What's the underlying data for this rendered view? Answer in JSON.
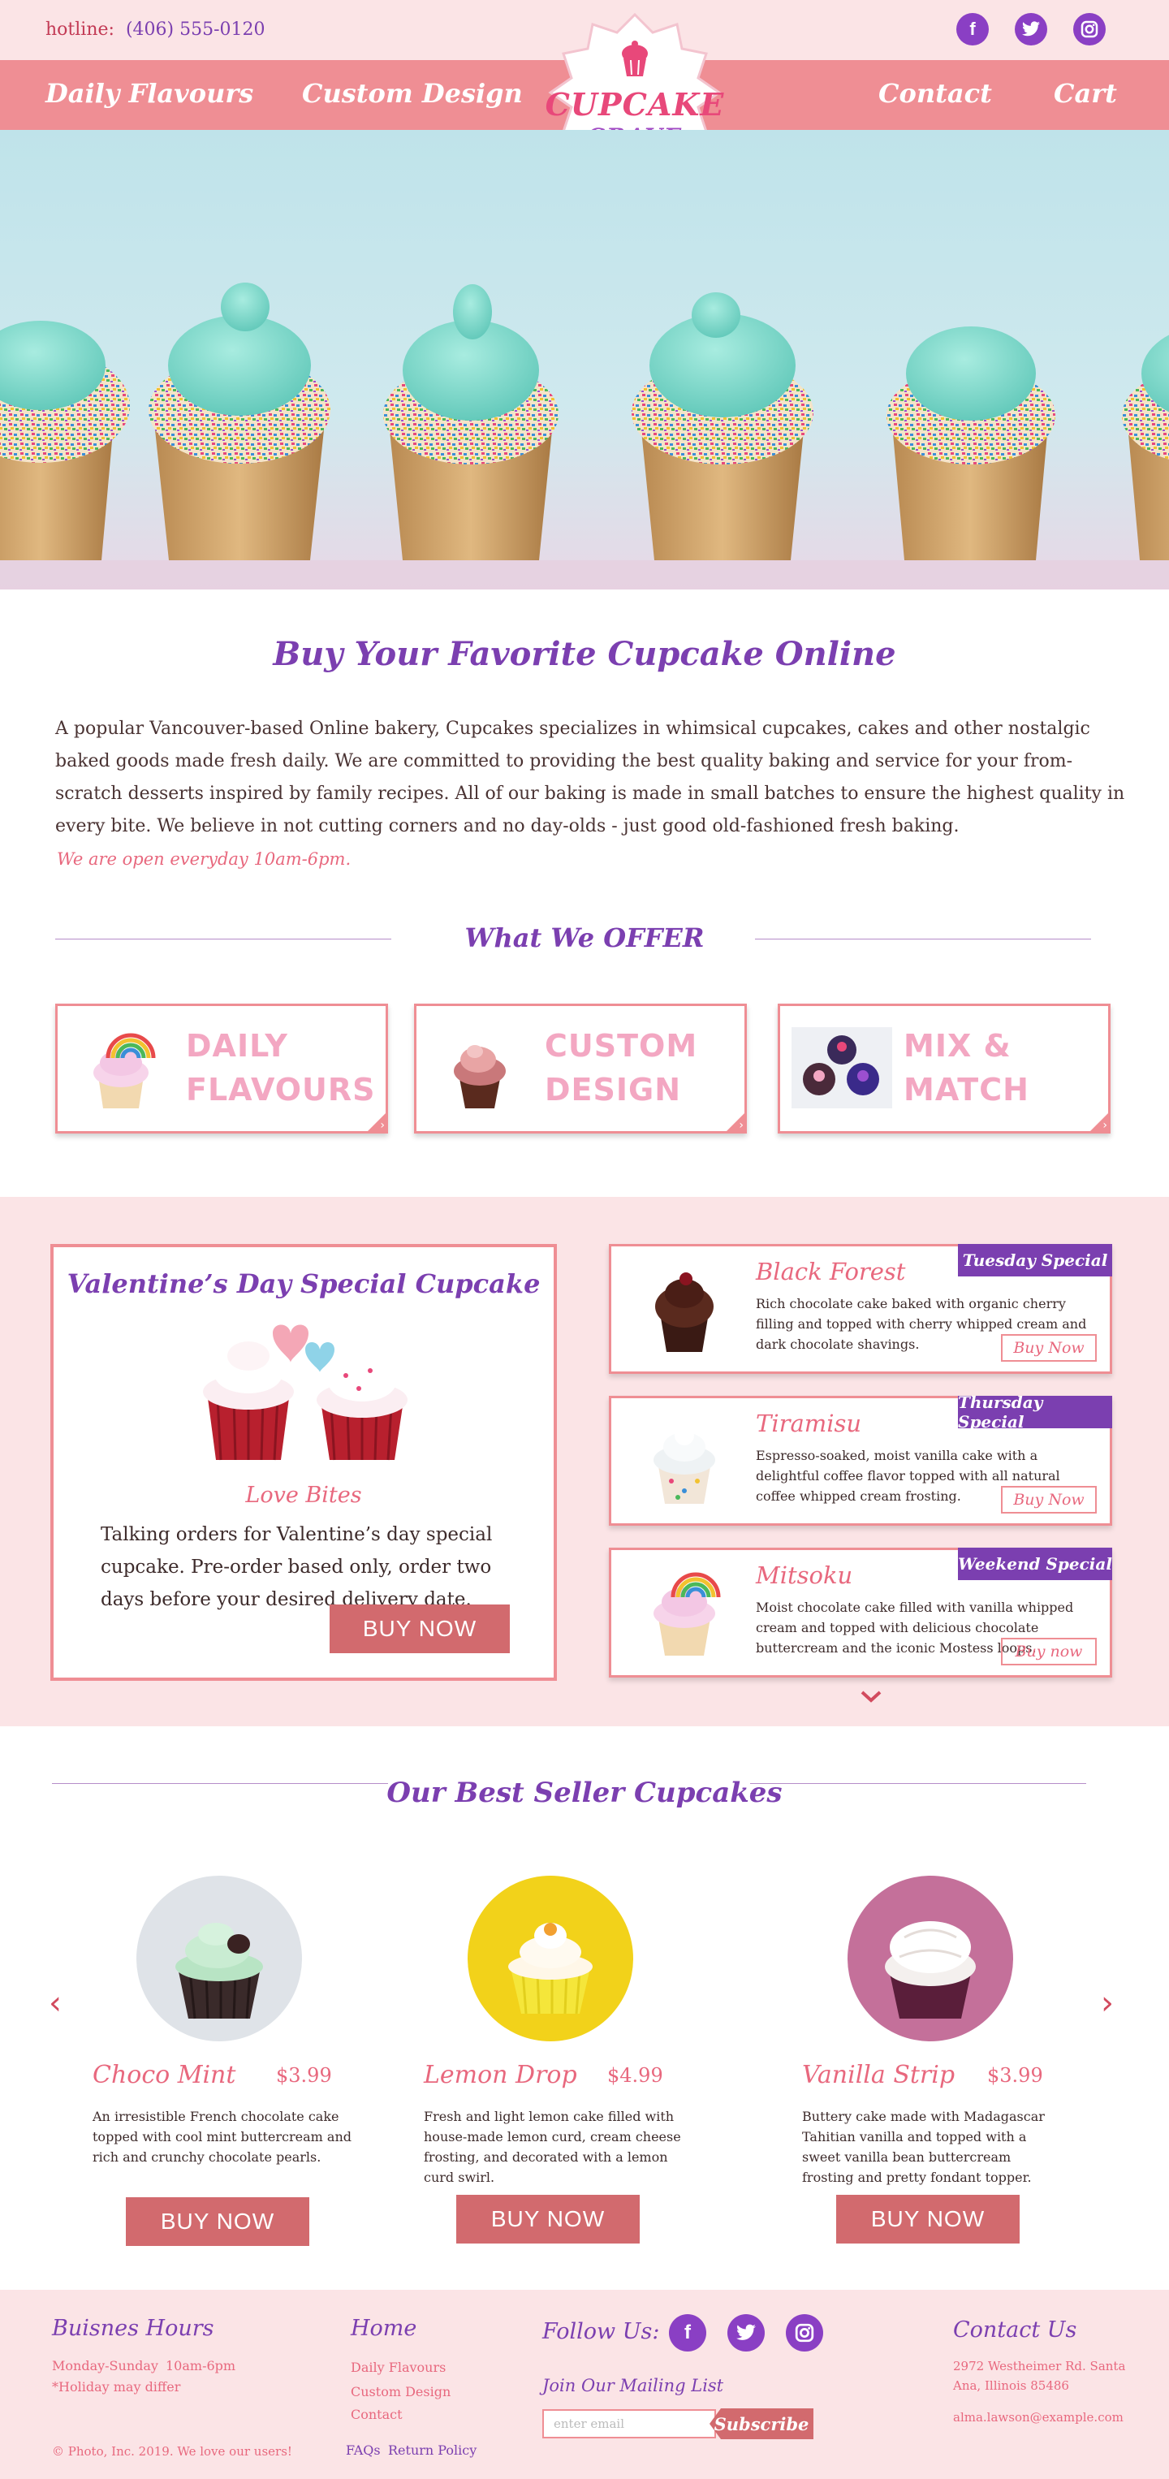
{
  "topbar": {
    "hotline_label": "hotline:",
    "hotline_number": "(406) 555-0120",
    "social": [
      "facebook-icon",
      "twitter-icon",
      "instagram-icon"
    ]
  },
  "nav": {
    "items": [
      "Daily Flavours",
      "Custom Design",
      "Contact",
      "Cart"
    ],
    "logo_line1": "CUPCAKE",
    "logo_line2": "CRAVE"
  },
  "intro": {
    "title": "Buy Your Favorite Cupcake Online",
    "text": "A popular Vancouver-based Online bakery, Cupcakes specializes in whimsical cupcakes, cakes and other nostalgic baked goods made fresh daily.  We are committed to providing the best quality baking and service for your  from-scratch desserts inspired by family recipes. All of our baking is made in small batches to ensure the highest quality in every bite. We believe in not cutting corners and no day-olds - just good old-fashioned fresh baking.",
    "hours": "We are open everyday 10am-6pm."
  },
  "offer": {
    "title": "What We OFFER",
    "cards": [
      {
        "line1": "DAILY",
        "line2": "FLAVOURS"
      },
      {
        "line1": "CUSTOM",
        "line2": "DESIGN"
      },
      {
        "line1": "MIX &",
        "line2": "MATCH"
      }
    ]
  },
  "valentine": {
    "title": "Valentine’s Day Special Cupcake",
    "subtitle": "Love Bites",
    "text": "Talking orders for Valentine’s day special cupcake. Pre-order based only, order  two days before your desired delivery date.",
    "button": "BUY NOW"
  },
  "specials": [
    {
      "tag": "Tuesday Special",
      "name": "Black Forest",
      "desc": "Rich chocolate cake baked with organic cherry filling and topped with cherry whipped cream and dark chocolate shavings.",
      "button": "Buy Now"
    },
    {
      "tag": "Thursday Special",
      "name": "Tiramisu",
      "desc": "Espresso-soaked, moist vanilla cake with a delightful coffee flavor topped with all natural coffee whipped cream frosting.",
      "button": "Buy Now"
    },
    {
      "tag": "Weekend Special",
      "name": "Mitsoku",
      "desc": "Moist chocolate cake filled with vanilla whipped cream and topped with delicious chocolate buttercream and the iconic Mostess loops.",
      "button": "Buy now"
    }
  ],
  "bestseller": {
    "title": "Our Best Seller Cupcakes",
    "items": [
      {
        "name": "Choco Mint",
        "price": "$3.99",
        "desc": "An irresistible French chocolate cake topped with cool mint buttercream and rich and crunchy chocolate pearls.",
        "button": "BUY NOW"
      },
      {
        "name": "Lemon Drop",
        "price": "$4.99",
        "desc": "Fresh and light lemon cake filled with house-made lemon curd, cream cheese frosting, and decorated with a lemon curd swirl.",
        "button": "BUY NOW"
      },
      {
        "name": "Vanilla Strip",
        "price": "$3.99",
        "desc": "Buttery cake made with Madagascar Tahitian vanilla and topped with a sweet vanilla bean buttercream frosting and pretty fondant topper.",
        "button": "BUY NOW"
      }
    ]
  },
  "footer": {
    "hours_title": "Buisnes Hours",
    "hours_days": "Monday-Sunday",
    "hours_time": "10am-6pm",
    "hours_note": "*Holiday may differ",
    "copyright": "© Photo, Inc. 2019. We love our users!",
    "home_title": "Home",
    "home_links": [
      "Daily Flavours",
      "Custom Design",
      "Contact"
    ],
    "bottom_links": [
      "FAQs",
      "Return Policy"
    ],
    "follow_title": "Follow Us:",
    "mail_title": "Join Our Mailing List",
    "mail_placeholder": "enter email",
    "mail_button": "Subscribe",
    "contact_title": "Contact Us",
    "address": "2972 Westheimer Rd. Santa Ana, Illinois 85486",
    "email": "alma.lawson@example.com"
  },
  "colors": {
    "accent_pink": "#ef8e94",
    "purple": "#7b3fb0",
    "button": "#d26a6e",
    "bg_pink": "#fbe4e6"
  }
}
